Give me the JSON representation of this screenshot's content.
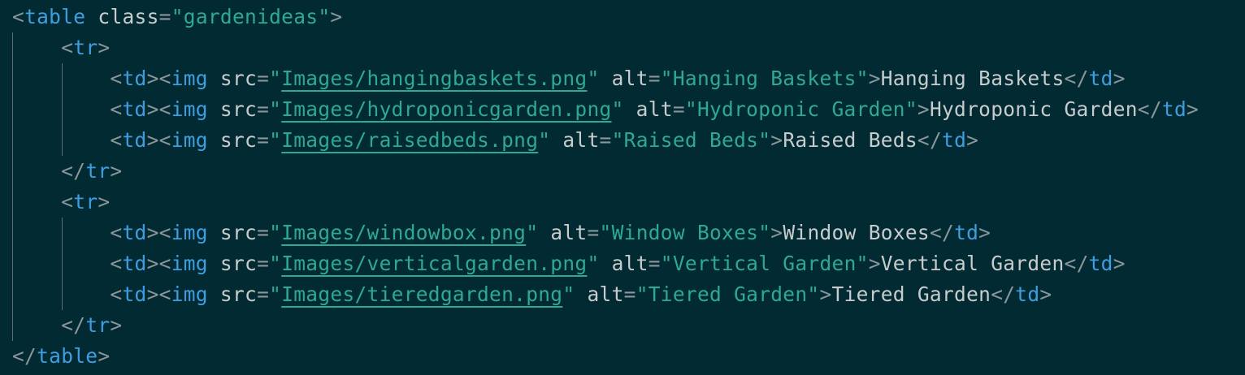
{
  "colors": {
    "background": "#022a33",
    "tag": "#3f9ee0",
    "string": "#2fa993",
    "text": "#c8cccc",
    "punctuation": "#8a9699",
    "indent_guide": "#5d6f74"
  },
  "code": {
    "table_open": {
      "tag": "table",
      "attr": "class",
      "value": "gardenideas"
    },
    "table_close_tag": "table",
    "rows": [
      {
        "open_tag": "tr",
        "close_tag": "tr",
        "cells": [
          {
            "src": "Images/hangingbaskets.png",
            "alt": "Hanging Baskets",
            "text": "Hanging Baskets"
          },
          {
            "src": "Images/hydroponicgarden.png",
            "alt": "Hydroponic Garden",
            "text": "Hydroponic Garden"
          },
          {
            "src": "Images/raisedbeds.png",
            "alt": "Raised Beds",
            "text": "Raised Beds"
          }
        ]
      },
      {
        "open_tag": "tr",
        "close_tag": "tr",
        "cells": [
          {
            "src": "Images/windowbox.png",
            "alt": "Window Boxes",
            "text": "Window Boxes"
          },
          {
            "src": "Images/verticalgarden.png",
            "alt": "Vertical Garden",
            "text": "Vertical Garden"
          },
          {
            "src": "Images/tieredgarden.png",
            "alt": "Tiered Garden",
            "text": "Tiered Garden"
          }
        ]
      }
    ]
  }
}
